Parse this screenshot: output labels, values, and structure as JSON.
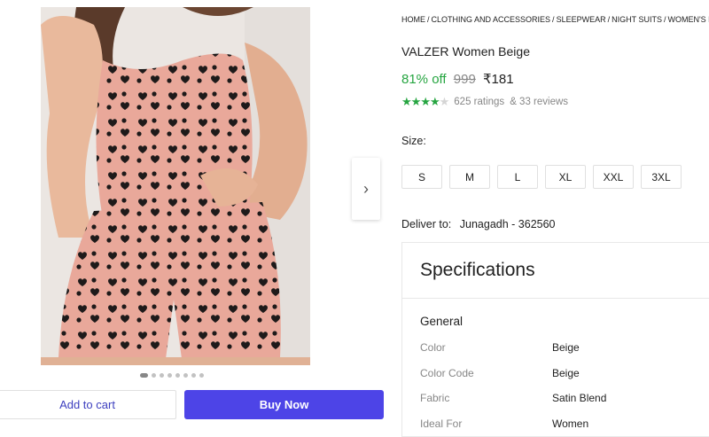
{
  "gallery": {
    "next_icon": "chevron-right-icon",
    "dots_count": 8,
    "active_dot": 0
  },
  "actions": {
    "add_to_cart": "Add to cart",
    "buy_now": "Buy Now"
  },
  "breadcrumb": [
    "HOME",
    "CLOTHING AND ACCESSORIES",
    "SLEEPWEAR",
    "NIGHT SUITS",
    "WOMEN'S NIGHT"
  ],
  "product": {
    "title": "VALZER Women Beige",
    "discount": "81% off",
    "mrp": "999",
    "price": "₹181",
    "rating_stars": 4,
    "ratings": "625 ratings",
    "reviews": "& 33 reviews"
  },
  "size": {
    "label": "Size:",
    "options": [
      "S",
      "M",
      "L",
      "XL",
      "XXL",
      "3XL"
    ]
  },
  "delivery": {
    "label": "Deliver to:",
    "place": "Junagadh - 362560"
  },
  "specifications": {
    "title": "Specifications",
    "group": "General",
    "rows": [
      {
        "key": "Color",
        "value": "Beige"
      },
      {
        "key": "Color Code",
        "value": "Beige"
      },
      {
        "key": "Fabric",
        "value": "Satin Blend"
      },
      {
        "key": "Ideal For",
        "value": "Women"
      }
    ]
  },
  "colors": {
    "accent_green": "#26a541",
    "buy_button": "#4d44e7",
    "fabric_pink": "#e8a99a"
  }
}
